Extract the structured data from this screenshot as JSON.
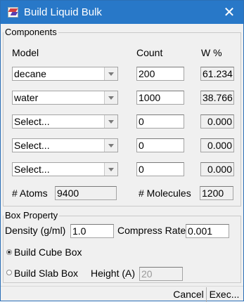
{
  "window": {
    "title": "Build Liquid Bulk"
  },
  "components": {
    "group_title": "Components",
    "headers": {
      "model": "Model",
      "count": "Count",
      "weight": "W %"
    },
    "rows": [
      {
        "model": "decane",
        "count": "200",
        "weight": "61.234"
      },
      {
        "model": "water",
        "count": "1000",
        "weight": "38.766"
      },
      {
        "model": "Select...",
        "count": "0",
        "weight": "0.000"
      },
      {
        "model": "Select...",
        "count": "0",
        "weight": "0.000"
      },
      {
        "model": "Select...",
        "count": "0",
        "weight": "0.000"
      }
    ],
    "atoms_label": "# Atoms",
    "atoms_value": "9400",
    "molecules_label": "# Molecules",
    "molecules_value": "1200"
  },
  "box": {
    "group_title": "Box Property",
    "density_label": "Density (g/ml)",
    "density_value": "1.0",
    "compress_label": "Compress Rate",
    "compress_value": "0.001",
    "cube_label": "Build Cube Box",
    "slab_label": "Build Slab Box",
    "height_label": "Height (A)",
    "height_value": "20",
    "selected": "cube"
  },
  "buttons": {
    "cancel": "Cancel",
    "exec": "Exec..."
  }
}
